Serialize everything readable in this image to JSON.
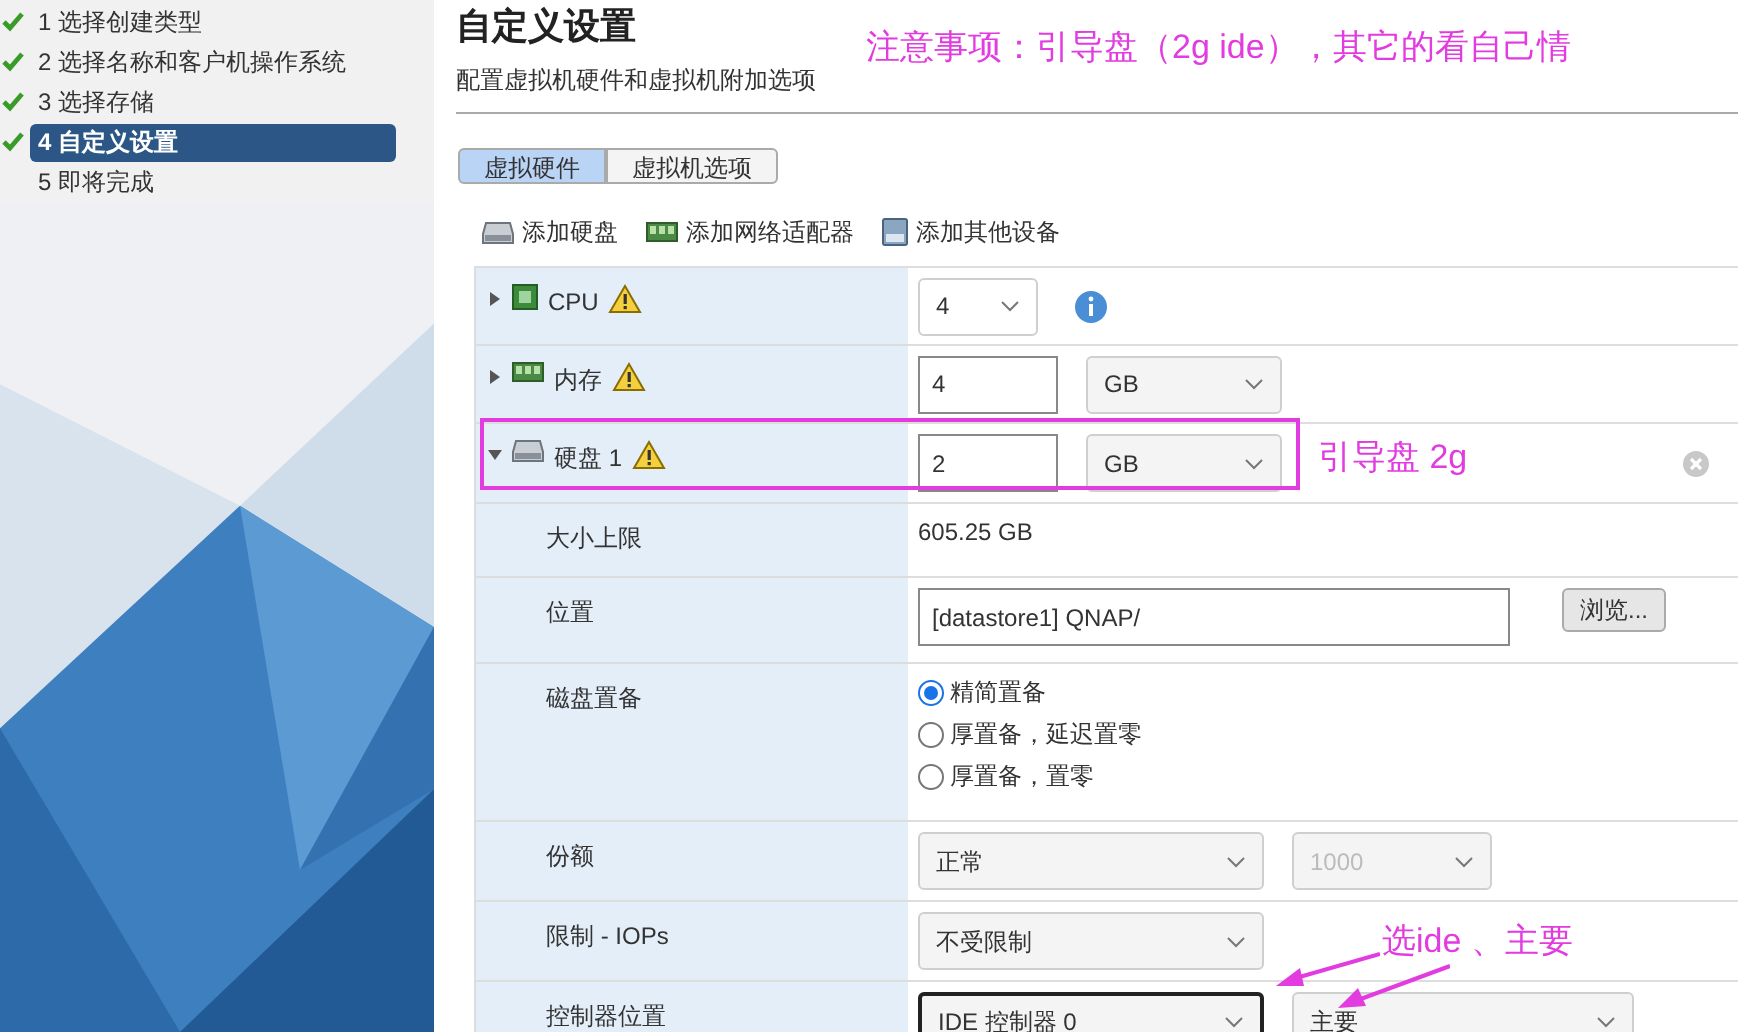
{
  "wizard_steps": [
    {
      "label": "1 选择创建类型",
      "done": true,
      "selected": false
    },
    {
      "label": "2 选择名称和客户机操作系统",
      "done": true,
      "selected": false
    },
    {
      "label": "3 选择存储",
      "done": true,
      "selected": false
    },
    {
      "label": "4 自定义设置",
      "done": true,
      "selected": true
    },
    {
      "label": "5 即将完成",
      "done": false,
      "selected": false
    }
  ],
  "title": "自定义设置",
  "subtitle": "配置虚拟机硬件和虚拟机附加选项",
  "tabs": [
    {
      "label": "虚拟硬件",
      "selected": true
    },
    {
      "label": "虚拟机选项",
      "selected": false
    }
  ],
  "toolbar": [
    {
      "kind": "disk",
      "label": "添加硬盘"
    },
    {
      "kind": "network",
      "label": "添加网络适配器"
    },
    {
      "kind": "device",
      "label": "添加其他设备"
    }
  ],
  "hardware": [
    {
      "kind": "cpu",
      "label": "CPU",
      "expanded": false,
      "warning": true,
      "controls": [
        {
          "kind": "number-select",
          "value": "4"
        },
        {
          "kind": "info"
        }
      ]
    },
    {
      "kind": "memory",
      "label": "内存",
      "expanded": false,
      "warning": true,
      "controls": [
        {
          "kind": "number-input",
          "value": "4"
        },
        {
          "kind": "unit-select",
          "value": "GB"
        }
      ]
    },
    {
      "kind": "disk",
      "label": "硬盘 1",
      "expanded": true,
      "warning": true,
      "removable": true,
      "controls": [
        {
          "kind": "number-input",
          "value": "2"
        },
        {
          "kind": "unit-select",
          "value": "GB"
        }
      ]
    },
    {
      "kind": "detail",
      "label": "大小上限",
      "controls": [
        {
          "kind": "text",
          "value": "605.25 GB"
        }
      ]
    },
    {
      "kind": "detail",
      "label": "位置",
      "controls": [
        {
          "kind": "path-input",
          "value": "[datastore1] QNAP/"
        },
        {
          "kind": "button",
          "label": "浏览..."
        }
      ]
    },
    {
      "kind": "detail",
      "label": "磁盘置备",
      "controls": [
        {
          "kind": "radio",
          "options": [
            {
              "label": "精简置备",
              "selected": true
            },
            {
              "label": "厚置备，延迟置零",
              "selected": false
            },
            {
              "label": "厚置备，置零",
              "selected": false
            }
          ]
        }
      ]
    },
    {
      "kind": "detail",
      "label": "份额",
      "controls": [
        {
          "kind": "select",
          "value": "正常",
          "disabled": false
        },
        {
          "kind": "level-select",
          "value": "1000",
          "disabled": true
        }
      ]
    },
    {
      "kind": "detail",
      "label": "限制 - IOPs",
      "controls": [
        {
          "kind": "select",
          "value": "不受限制",
          "disabled": false
        }
      ]
    },
    {
      "kind": "detail",
      "label": "控制器位置",
      "controls": [
        {
          "kind": "select",
          "value": "IDE 控制器 0",
          "disabled": false,
          "focused": true
        },
        {
          "kind": "wide-select",
          "value": "主要",
          "disabled": false
        }
      ]
    }
  ],
  "annotations": {
    "note": "注意事项：引导盘（2g ide），其它的看自己情",
    "disk_note": "引导盘 2g",
    "controller_note": "选ide 、主要"
  }
}
